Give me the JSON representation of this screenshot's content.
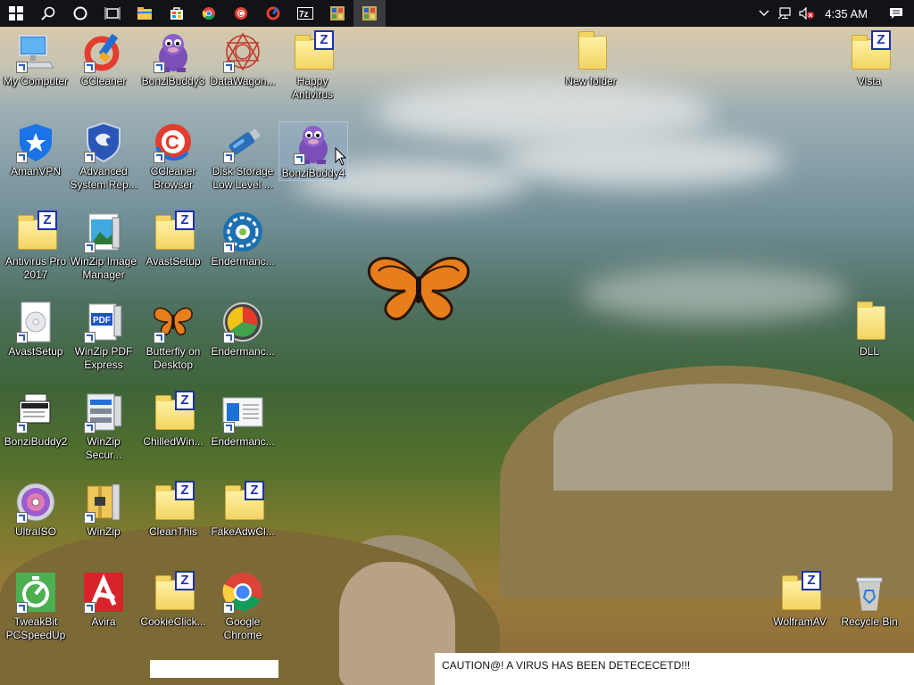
{
  "taskbar": {
    "items": [
      {
        "name": "start-button",
        "icon": "windows-logo-icon"
      },
      {
        "name": "search-button",
        "icon": "search-icon"
      },
      {
        "name": "cortana-button",
        "icon": "cortana-circle-icon"
      },
      {
        "name": "task-view-button",
        "icon": "task-view-icon"
      },
      {
        "name": "file-explorer-button",
        "icon": "folder-icon"
      },
      {
        "name": "store-button",
        "icon": "store-bag-icon"
      },
      {
        "name": "chrome-button",
        "icon": "chrome-icon"
      },
      {
        "name": "ccleaner-browser-button",
        "icon": "ccleaner-icon"
      },
      {
        "name": "ccleaner-button",
        "icon": "ccleaner-brush-icon"
      },
      {
        "name": "7zip-button",
        "icon": "7zip-icon"
      },
      {
        "name": "app-button",
        "icon": "app-grid-icon"
      },
      {
        "name": "active-app-button",
        "icon": "app-grid-icon"
      }
    ],
    "tray": {
      "clock": "4:35 AM",
      "icons": [
        "chevron-up-icon",
        "network-icon",
        "volume-muted-icon",
        "action-center-icon"
      ]
    }
  },
  "desktop": {
    "icons": [
      {
        "label": "My Computer",
        "type": "computer"
      },
      {
        "label": "CCleaner",
        "type": "ccleaner"
      },
      {
        "label": "BonziBuddy3",
        "type": "bonzi"
      },
      {
        "label": "DataWagon...",
        "type": "datawagon"
      },
      {
        "label": "Happy Antivirus",
        "type": "zfolder"
      },
      {
        "label": "New folder",
        "type": "folder-plain"
      },
      {
        "label": "Vista",
        "type": "zfolder"
      },
      {
        "label": "AmanVPN",
        "type": "shield-blue"
      },
      {
        "label": "Advanced System Rep...",
        "type": "shield-dragon"
      },
      {
        "label": "CCleaner Browser",
        "type": "ccleaner-browser"
      },
      {
        "label": "Disk Storage Low Level ...",
        "type": "usb-drive"
      },
      {
        "label": "BonziBuddy4",
        "type": "bonzi"
      },
      {
        "label": "Antivirus Pro 2017",
        "type": "zfolder"
      },
      {
        "label": "WinZip Image Manager",
        "type": "winzip-image"
      },
      {
        "label": "AvastSetup",
        "type": "zfolder"
      },
      {
        "label": "Endermanc...",
        "type": "endermanch-gear"
      },
      {
        "label": "AvastSetup",
        "type": "disc-file"
      },
      {
        "label": "WinZip PDF Express",
        "type": "winzip-pdf"
      },
      {
        "label": "Butterfly on Desktop",
        "type": "butterfly"
      },
      {
        "label": "Endermanc...",
        "type": "endermanch-pie"
      },
      {
        "label": "DLL",
        "type": "folder-plain"
      },
      {
        "label": "BonziBuddy2",
        "type": "bonzi-doc"
      },
      {
        "label": "WinZip Secur...",
        "type": "winzip-secure"
      },
      {
        "label": "ChilledWin...",
        "type": "zfolder"
      },
      {
        "label": "Endermanc...",
        "type": "endermanch-window"
      },
      {
        "label": "UltraISO",
        "type": "ultraiso"
      },
      {
        "label": "WinZip",
        "type": "winzip"
      },
      {
        "label": "CleanThis",
        "type": "zfolder"
      },
      {
        "label": "FakeAdwCl...",
        "type": "zfolder"
      },
      {
        "label": "TweakBit PCSpeedUp",
        "type": "tweakbit"
      },
      {
        "label": "Avira",
        "type": "avira"
      },
      {
        "label": "CookieClick...",
        "type": "zfolder"
      },
      {
        "label": "Google Chrome",
        "type": "chrome"
      },
      {
        "label": "WolframAV",
        "type": "zfolder"
      },
      {
        "label": "Recycle Bin",
        "type": "recycle-bin"
      }
    ]
  },
  "caption": "CAUTION@! A VIRUS HAS BEEN DETECECETD!!!"
}
